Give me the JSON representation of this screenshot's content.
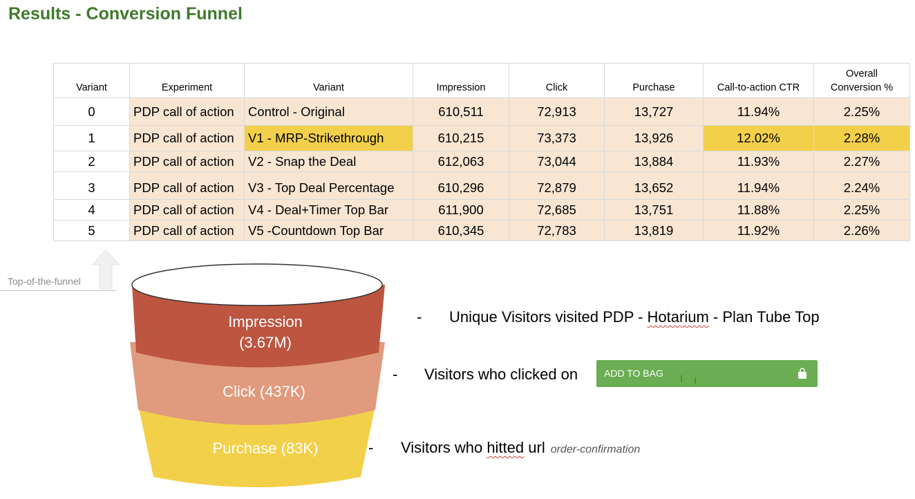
{
  "title": "Results - Conversion Funnel",
  "table": {
    "headers": [
      "Variant",
      "Experiment",
      "Variant",
      "Impression",
      "Click",
      "Purchase",
      "Call-to-action CTR",
      "Overall Conversion %"
    ],
    "rows": [
      {
        "variant": "0",
        "experiment": "PDP call of action",
        "name": "Control - Original",
        "impression": "610,511",
        "click": "72,913",
        "purchase": "13,727",
        "ctr": "11.94%",
        "conversion": "2.25%"
      },
      {
        "variant": "1",
        "experiment": "PDP call of action",
        "name": "V1 - MRP-Strikethrough",
        "impression": "610,215",
        "click": "73,373",
        "purchase": "13,926",
        "ctr": "12.02%",
        "conversion": "2.28%"
      },
      {
        "variant": "2",
        "experiment": "PDP call of action",
        "name": "V2 - Snap the Deal",
        "impression": "612,063",
        "click": "73,044",
        "purchase": "13,884",
        "ctr": "11.93%",
        "conversion": "2.27%"
      },
      {
        "variant": "3",
        "experiment": "PDP call of action",
        "name": "V3 - Top Deal Percentage",
        "impression": "610,296",
        "click": "72,879",
        "purchase": "13,652",
        "ctr": "11.94%",
        "conversion": "2.24%"
      },
      {
        "variant": "4",
        "experiment": "PDP call of action",
        "name": "V4 - Deal+Timer Top Bar",
        "impression": "611,900",
        "click": "72,685",
        "purchase": "13,751",
        "ctr": "11.88%",
        "conversion": "2.25%"
      },
      {
        "variant": "5",
        "experiment": "PDP call of action",
        "name": "V5 -Countdown Top Bar",
        "impression": "610,345",
        "click": "72,783",
        "purchase": "13,819",
        "ctr": "11.92%",
        "conversion": "2.26%"
      }
    ]
  },
  "funnel": {
    "top_label": "Top-of-the-funnel",
    "impression": {
      "label": "Impression",
      "value": "(3.67M)"
    },
    "click": {
      "label": "Click (437K)"
    },
    "purchase": {
      "label": "Purchase (83K)"
    },
    "colors": {
      "impression": "#bd5540",
      "click": "#e09a7d",
      "purchase": "#f3d04a"
    }
  },
  "descriptions": {
    "dash": "-",
    "impression_pre": "Unique Visitors visited PDP - ",
    "impression_brand": "Hotarium",
    "impression_post": " - Plan Tube Top",
    "click": "Visitors who clicked on",
    "add_to_bag": "ADD TO BAG",
    "purchase_pre": "Visitors who ",
    "purchase_word": "hitted",
    "purchase_post": " url",
    "purchase_url": "order-confirmation"
  },
  "colors": {
    "title": "#3f7a2c",
    "row_bg": "#f8e6d3",
    "highlight": "#f3d04a",
    "button": "#6aad52"
  }
}
